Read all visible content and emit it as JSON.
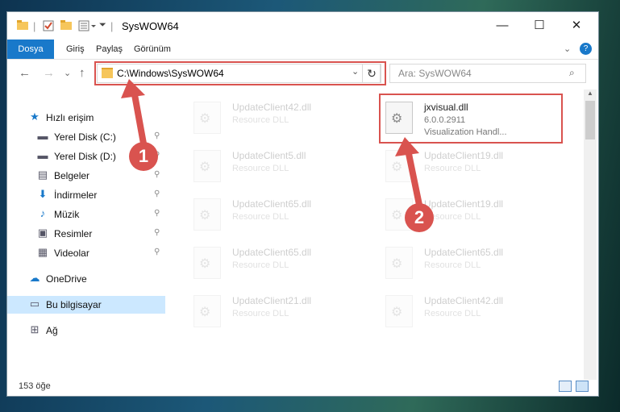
{
  "window": {
    "title": "SysWOW64",
    "controls": {
      "minimize": "—",
      "maximize": "☐",
      "close": "✕"
    }
  },
  "ribbon": {
    "tabs": [
      "Dosya",
      "Giriş",
      "Paylaş",
      "Görünüm"
    ],
    "expand": "⌄",
    "help": "?"
  },
  "address": {
    "path": "C:\\Windows\\SysWOW64",
    "dropdown": "⌄",
    "refresh": "↻"
  },
  "search": {
    "placeholder": "Ara: SysWOW64",
    "icon": "⌕"
  },
  "nav_buttons": {
    "back": "←",
    "forward": "→",
    "recent": "⌄",
    "up": "↑"
  },
  "sidebar": {
    "items": [
      {
        "label": "Hızlı erişim",
        "icon": "star-icon",
        "glyph": "★",
        "pinned": false
      },
      {
        "label": "Yerel Disk (C:)",
        "icon": "drive-icon",
        "glyph": "▬",
        "pinned": true
      },
      {
        "label": "Yerel Disk (D:)",
        "icon": "drive-icon",
        "glyph": "▬",
        "pinned": true
      },
      {
        "label": "Belgeler",
        "icon": "documents-icon",
        "glyph": "▤",
        "pinned": true
      },
      {
        "label": "İndirmeler",
        "icon": "download-icon",
        "glyph": "⬇",
        "pinned": true
      },
      {
        "label": "Müzik",
        "icon": "music-icon",
        "glyph": "♪",
        "pinned": true
      },
      {
        "label": "Resimler",
        "icon": "pictures-icon",
        "glyph": "▣",
        "pinned": true
      },
      {
        "label": "Videolar",
        "icon": "videos-icon",
        "glyph": "▦",
        "pinned": true
      },
      {
        "label": "OneDrive",
        "icon": "cloud-icon",
        "glyph": "☁",
        "pinned": false
      },
      {
        "label": "Bu bilgisayar",
        "icon": "computer-icon",
        "glyph": "▭",
        "pinned": false
      },
      {
        "label": "Ağ",
        "icon": "network-icon",
        "glyph": "⊞",
        "pinned": false
      }
    ],
    "pin_glyph": "📌"
  },
  "files": [
    {
      "name": "UpdateClient42.dll",
      "type": "Resource DLL",
      "desc": ""
    },
    {
      "name": "jxvisual.dll",
      "type": "6.0.0.2911",
      "desc": "Visualization Handl..."
    },
    {
      "name": "UpdateClient5.dll",
      "type": "Resource DLL",
      "desc": ""
    },
    {
      "name": "UpdateClient19.dll",
      "type": "Resource DLL",
      "desc": ""
    },
    {
      "name": "UpdateClient65.dll",
      "type": "Resource DLL",
      "desc": ""
    },
    {
      "name": "UpdateClient19.dll",
      "type": "Resource DLL",
      "desc": ""
    },
    {
      "name": "UpdateClient65.dll",
      "type": "Resource DLL",
      "desc": ""
    },
    {
      "name": "UpdateClient65.dll",
      "type": "Resource DLL",
      "desc": ""
    },
    {
      "name": "UpdateClient21.dll",
      "type": "Resource DLL",
      "desc": ""
    },
    {
      "name": "UpdateClient42.dll",
      "type": "Resource DLL",
      "desc": ""
    }
  ],
  "status": {
    "item_count": "153 öğe"
  },
  "annotations": {
    "step1": "1",
    "step2": "2",
    "highlight_color": "#d9534f"
  },
  "colors": {
    "accent": "#1979ca",
    "selected_nav": "#cce8ff"
  }
}
